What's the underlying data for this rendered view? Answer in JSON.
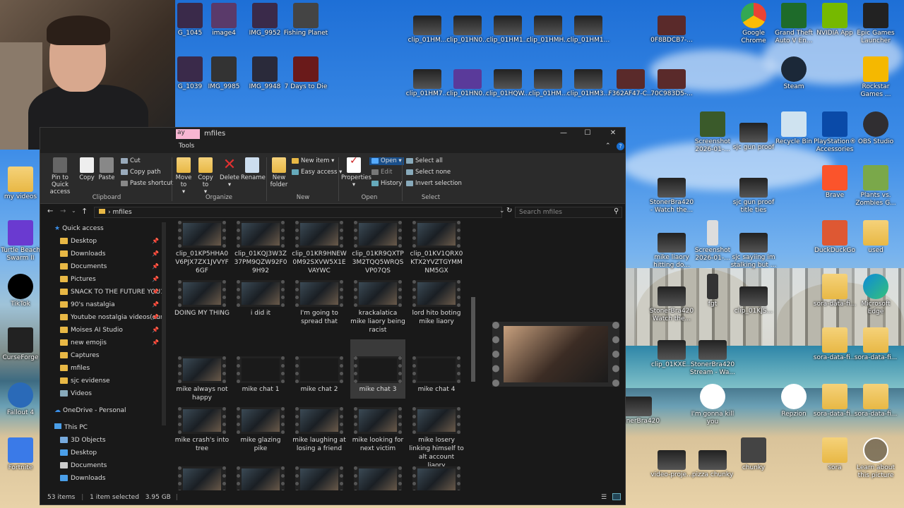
{
  "desktop": {
    "icons": [
      {
        "label": "G_1045",
        "x": 0,
        "y": 0
      },
      {
        "label": "image4"
      },
      {
        "label": "IMG_9952"
      },
      {
        "label": "Fishing Planet"
      },
      {
        "label": "G_1039"
      },
      {
        "label": "IMG_9985"
      },
      {
        "label": "IMG_9948"
      },
      {
        "label": "7 Days to Die"
      },
      {
        "label": "clip_01HM..."
      },
      {
        "label": "clip_01HN0..."
      },
      {
        "label": "clip_01HM1..."
      },
      {
        "label": "clip_01HMH..."
      },
      {
        "label": "clip_01HM1..."
      },
      {
        "label": "0F8BDCB7-..."
      },
      {
        "label": "Google Chrome"
      },
      {
        "label": "Grand Theft Auto V En..."
      },
      {
        "label": "NVIDIA App"
      },
      {
        "label": "Epic Games Launcher"
      },
      {
        "label": "clip_01HM7..."
      },
      {
        "label": "clip_01HN0..."
      },
      {
        "label": "clip_01HQW..."
      },
      {
        "label": "clip_01HM..."
      },
      {
        "label": "clip_01HM3..."
      },
      {
        "label": "F362AF47-C..."
      },
      {
        "label": "70C983D5-..."
      },
      {
        "label": "Steam"
      },
      {
        "label": "Rockstar Games ..."
      },
      {
        "label": "Screenshot 2026-01-..."
      },
      {
        "label": "sjc gun proof"
      },
      {
        "label": "Recycle Bin"
      },
      {
        "label": "PlayStation® Accessories"
      },
      {
        "label": "OBS Studio"
      },
      {
        "label": "my videos"
      },
      {
        "label": "StonerBra420 - Watch the..."
      },
      {
        "label": "sjc gun proof title ties"
      },
      {
        "label": "Brave"
      },
      {
        "label": "Plants vs. Zombies G..."
      },
      {
        "label": "Turtle Beach Swarm II"
      },
      {
        "label": "mike liaory hitting do..."
      },
      {
        "label": "Screenshot 2026-01-..."
      },
      {
        "label": "sjc sayiing im stalking but ..."
      },
      {
        "label": "DuckDuckGo"
      },
      {
        "label": "used"
      },
      {
        "label": "TikTok"
      },
      {
        "label": "StonerBra420 Watch the..."
      },
      {
        "label": "fgt"
      },
      {
        "label": "clip_01KJS..."
      },
      {
        "label": "sora-data-fi..."
      },
      {
        "label": "Microsoft Edge"
      },
      {
        "label": "CurseForge"
      },
      {
        "label": "clip_01KXE..."
      },
      {
        "label": "StonerBra420 Stream - Wa..."
      },
      {
        "label": "sora-data-fi..."
      },
      {
        "label": "sora-data-fi..."
      },
      {
        "label": "Fallout 4"
      },
      {
        "label": "StonerBra420"
      },
      {
        "label": "I'm gonna kill you"
      },
      {
        "label": "Repzion"
      },
      {
        "label": "sora-data-fi..."
      },
      {
        "label": "sora-data-fi..."
      },
      {
        "label": "Fortnite"
      },
      {
        "label": "video-proje..."
      },
      {
        "label": "pizza chunky"
      },
      {
        "label": "chunky"
      },
      {
        "label": "sora"
      },
      {
        "label": "Learn about this picture"
      }
    ]
  },
  "explorer": {
    "title": "mfiles",
    "tab_label": "ay",
    "tools_label": "Tools",
    "ribbon": {
      "pin": "Pin to Quick access",
      "copy": "Copy",
      "paste": "Paste",
      "cut": "Cut",
      "copy_path": "Copy path",
      "paste_shortcut": "Paste shortcut",
      "clipboard": "Clipboard",
      "move_to": "Move to",
      "copy_to": "Copy to",
      "delete": "Delete",
      "rename": "Rename",
      "organize": "Organize",
      "new_folder": "New folder",
      "new_item": "New item",
      "easy_access": "Easy access",
      "new": "New",
      "properties": "Properties",
      "open": "Open",
      "edit": "Edit",
      "history": "History",
      "open_group": "Open",
      "select_all": "Select all",
      "select_none": "Select none",
      "invert": "Invert selection",
      "select": "Select"
    },
    "address": "mfiles",
    "search_placeholder": "Search mfiles",
    "nav": [
      {
        "label": "Quick access",
        "pinned": false
      },
      {
        "label": "Desktop",
        "pinned": true
      },
      {
        "label": "Downloads",
        "pinned": true
      },
      {
        "label": "Documents",
        "pinned": true
      },
      {
        "label": "Pictures",
        "pinned": true
      },
      {
        "label": "SNACK TO THE FUTURE YOU1",
        "pinned": true
      },
      {
        "label": "90's nastalgia",
        "pinned": true
      },
      {
        "label": "Youtube nostalgia videos(our",
        "pinned": true
      },
      {
        "label": "Moises AI Studio",
        "pinned": true
      },
      {
        "label": "new emojis",
        "pinned": true
      },
      {
        "label": "Captures",
        "pinned": false
      },
      {
        "label": "mfiles",
        "pinned": false
      },
      {
        "label": "sjc evidense",
        "pinned": false
      },
      {
        "label": "Videos",
        "pinned": false
      },
      {
        "label": "OneDrive - Personal",
        "pinned": false
      },
      {
        "label": "This PC",
        "pinned": false
      },
      {
        "label": "3D Objects",
        "pinned": false
      },
      {
        "label": "Desktop",
        "pinned": false
      },
      {
        "label": "Documents",
        "pinned": false
      },
      {
        "label": "Downloads",
        "pinned": false
      }
    ],
    "files": [
      {
        "name": "clip_01KP5HHA0V6PJX7ZX1JVVYF6GF"
      },
      {
        "name": "clip_01KQJ3W3Z37PM9QZW92F09H92"
      },
      {
        "name": "clip_01KR9HNEW0M92SXVW5X1EVAYWC"
      },
      {
        "name": "clip_01KR9QXTP3M2TQQ5WRQSVP07QS"
      },
      {
        "name": "clip_01KV1QRX0KTX2YVZTGYMMNM5GX"
      },
      {
        "name": "DOING MY THING"
      },
      {
        "name": "i did it"
      },
      {
        "name": "I'm going to spread that"
      },
      {
        "name": "krackalatica mike liaory being racist"
      },
      {
        "name": "lord hito boting mike liaory"
      },
      {
        "name": "mike always not happy"
      },
      {
        "name": "mike chat 1"
      },
      {
        "name": "mike chat 2"
      },
      {
        "name": "mike chat 3"
      },
      {
        "name": "mike chat 4"
      },
      {
        "name": "mike crash's into tree"
      },
      {
        "name": "mike glazing pike"
      },
      {
        "name": "mike laughing at losing a friend"
      },
      {
        "name": "mike looking for next victim"
      },
      {
        "name": "mike losery linking himself to alt account liaory"
      }
    ],
    "status": {
      "items": "53 items",
      "selected": "1 item selected",
      "size": "3.95 GB"
    }
  }
}
